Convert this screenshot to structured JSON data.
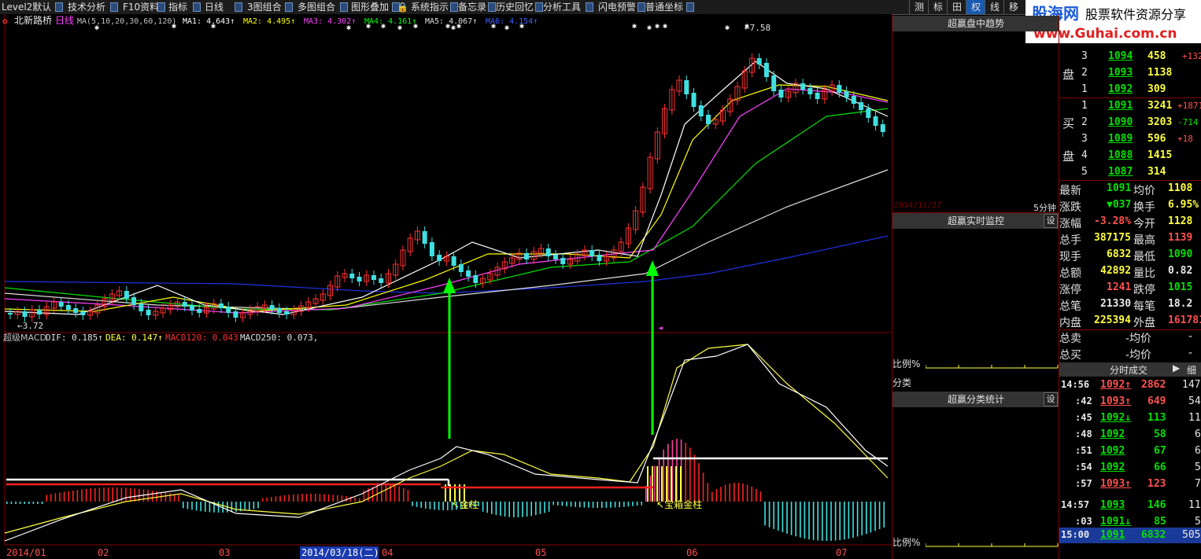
{
  "menubar": {
    "items": [
      "Level2默认",
      "技术分析",
      "F10资料",
      "指标",
      "日线",
      "3图组合",
      "多图组合",
      "图形叠加",
      "系统指示",
      "备忘录",
      "历史回忆",
      "分析工具",
      "闪电预警",
      "普通坐标"
    ],
    "right_buttons": [
      "测",
      "标",
      "田",
      "权",
      "线",
      "移"
    ]
  },
  "logo": {
    "brand": "股海网",
    "slogan": "股票软件资源分享",
    "url": "www.Guhai.com.cn"
  },
  "main_chart": {
    "stock_name": "北新路桥",
    "period": "日线",
    "ma_spec": "MA(5,10,20,30,60,120)",
    "ma_values": [
      {
        "label": "MA1: 4.643↑",
        "color": "#ffffff"
      },
      {
        "label": "MA2: 4.495↑",
        "color": "#ffff00"
      },
      {
        "label": "MA3: 4.302↑",
        "color": "#ff40ff"
      },
      {
        "label": "MA4: 4.161↑",
        "color": "#00ff00"
      },
      {
        "label": "MA5: 4.067↑",
        "color": "#e0e0e0"
      },
      {
        "label": "MA6: 4.154↑",
        "color": "#4060ff"
      }
    ],
    "high_label": "7.58",
    "low_label": "3.72"
  },
  "macd": {
    "name": "超级MACD",
    "dif": "DIF: 0.185↑",
    "dea": "DEA: 0.147↑",
    "macd120": "MACD120: 0.043",
    "macd250": "MACD250: 0.073,",
    "tag_gold": "金柱",
    "tag_treasure": "宝箱金柱"
  },
  "xaxis": {
    "labels": [
      "2014/01",
      "02",
      "03",
      "04",
      "05",
      "06",
      "07"
    ],
    "cursor_date": "2014/03/18(二)"
  },
  "right_panel": {
    "trend_title": "超赢盘中趋势",
    "trend_date": "2014/11/27",
    "trend_period": "5分钟",
    "monitor_title": "超赢实时监控",
    "ratio_label": "比例%",
    "class_label": "分类",
    "stats_title": "超赢分类统计",
    "ratio_label2": "比例%",
    "set_label": "设"
  },
  "quote": {
    "sell_label_1": "卖",
    "sell_label_2": "盘",
    "buy_label_1": "买",
    "buy_label_2": "盘",
    "sell": [
      {
        "n": "3",
        "p": "1094",
        "v": "458",
        "c": "+132"
      },
      {
        "n": "2",
        "p": "1093",
        "v": "1138",
        "c": ""
      },
      {
        "n": "1",
        "p": "1092",
        "v": "309",
        "c": ""
      }
    ],
    "buy": [
      {
        "n": "1",
        "p": "1091",
        "v": "3241",
        "c": "+1871"
      },
      {
        "n": "2",
        "p": "1090",
        "v": "3203",
        "c": "-714"
      },
      {
        "n": "3",
        "p": "1089",
        "v": "596",
        "c": "+18"
      },
      {
        "n": "4",
        "p": "1088",
        "v": "1415",
        "c": ""
      },
      {
        "n": "5",
        "p": "1087",
        "v": "314",
        "c": ""
      }
    ],
    "stats": [
      {
        "k1": "最新",
        "v1": "1091",
        "k2": "均价",
        "v2": "1108"
      },
      {
        "k1": "涨跌",
        "v1": "▼037",
        "k2": "换手",
        "v2": "6.95%"
      },
      {
        "k1": "涨幅",
        "v1": "-3.28%",
        "k2": "今开",
        "v2": "1128"
      },
      {
        "k1": "总手",
        "v1": "387175",
        "k2": "最高",
        "v2": "1139"
      },
      {
        "k1": "现手",
        "v1": "6832",
        "k2": "最低",
        "v2": "1090"
      },
      {
        "k1": "总额",
        "v1": "42892",
        "k2": "量比",
        "v2": "0.82"
      },
      {
        "k1": "涨停",
        "v1": "1241",
        "k2": "跌停",
        "v2": "1015"
      },
      {
        "k1": "总笔",
        "v1": "21330",
        "k2": "每笔",
        "v2": "18.2"
      },
      {
        "k1": "内盘",
        "v1": "225394",
        "k2": "外盘",
        "v2": "161781"
      }
    ],
    "total_sell": {
      "k": "总卖",
      "v": "-均价",
      "w": "-"
    },
    "total_buy": {
      "k": "总买",
      "v": "-均价",
      "w": "-"
    },
    "ticks_title": "分时成交",
    "ticks_btn": "细",
    "ticks": [
      {
        "t": "14:56",
        "p": "1092↑",
        "v": "2862",
        "n": "147"
      },
      {
        "t": ":42",
        "p": "1093↑",
        "v": "649",
        "n": "54"
      },
      {
        "t": ":45",
        "p": "1092↓",
        "v": "113",
        "n": "11"
      },
      {
        "t": ":48",
        "p": "1092",
        "v": "58",
        "n": "6"
      },
      {
        "t": ":51",
        "p": "1092",
        "v": "67",
        "n": "6"
      },
      {
        "t": ":54",
        "p": "1092",
        "v": "66",
        "n": "5"
      },
      {
        "t": ":57",
        "p": "1093↑",
        "v": "123",
        "n": "7"
      },
      {
        "t": "14:57",
        "p": "1093",
        "v": "146",
        "n": "11"
      },
      {
        "t": ":03",
        "p": "1091↓",
        "v": "85",
        "n": "5"
      },
      {
        "t": "15:00",
        "p": "1091",
        "v": "6832",
        "n": "505"
      }
    ]
  }
}
